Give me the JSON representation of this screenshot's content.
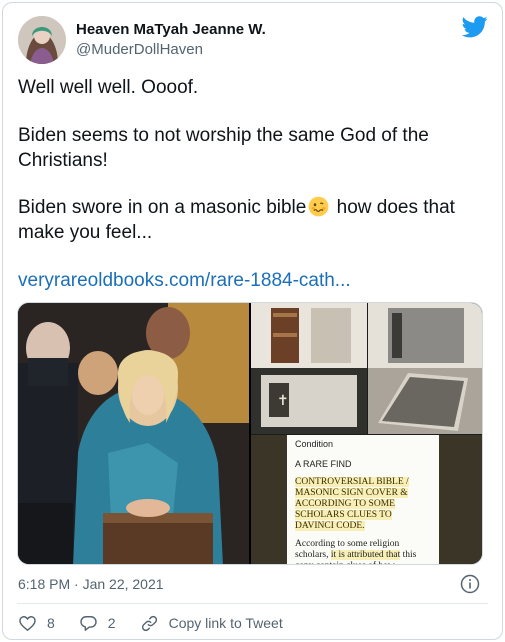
{
  "tweet": {
    "author_name": "Heaven MaTyah Jeanne W.",
    "author_handle": "@MuderDollHaven",
    "paragraph_1": "Well well well. Oooof.",
    "paragraph_2": "Biden seems to not worship the same God of the Christians!",
    "paragraph_3_before_emoji": "Biden swore in on a masonic bible",
    "paragraph_3_after_emoji": " how does that make you feel...",
    "emoji_icon": "woozy-face-emoji",
    "link_text": "veryrareoldbooks.com/rare-1884-cath...",
    "timestamp": "6:18 PM · Jan 22, 2021"
  },
  "media": {
    "document": {
      "heading": "Condition",
      "subheading": "A RARE FIND",
      "highlight": "Controversial Bible / Masonic Sign Cover & According to Some Scholars Clues to DaVinci Code.",
      "para_start": "According to some religion scholars, ",
      "para_highlight": "it is attributed that",
      "para_cut": "this copy contain clues of how"
    }
  },
  "actions": {
    "like_count": "8",
    "reply_count": "2",
    "copy_label": "Copy link to Tweet"
  },
  "colors": {
    "accent": "#1d9bf0",
    "link": "#1b6fb8",
    "muted": "#536471"
  },
  "icons": [
    "twitter-bird-icon",
    "info-icon",
    "heart-icon",
    "reply-icon",
    "link-icon"
  ]
}
